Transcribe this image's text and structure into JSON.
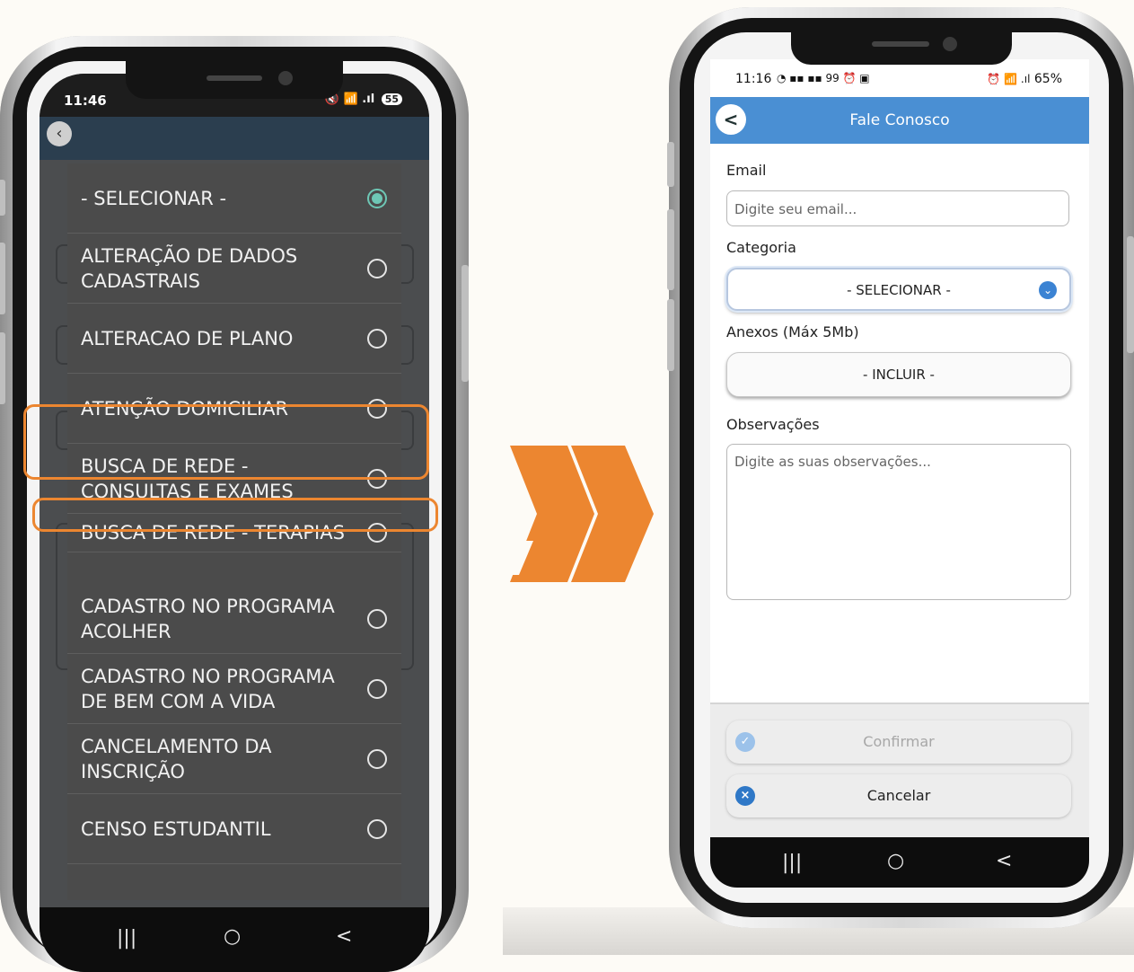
{
  "left_phone": {
    "status_bar": {
      "time": "11:46",
      "icons": "🔇 📶 .ıl",
      "battery": "55"
    },
    "dropdown": {
      "items": [
        {
          "label": "- SELECIONAR -",
          "selected": true
        },
        {
          "label": "ALTERAÇÃO DE DADOS\nCADASTRAIS",
          "selected": false
        },
        {
          "label": "ALTERACAO DE PLANO",
          "selected": false
        },
        {
          "label": "ATENÇÃO DOMICILIAR",
          "selected": false
        },
        {
          "label": "BUSCA DE REDE -\nCONSULTAS E EXAMES",
          "selected": false
        },
        {
          "label": "BUSCA DE REDE - TERAPIAS",
          "selected": false
        },
        {
          "label": "CADASTRO NO PROGRAMA\nACOLHER",
          "selected": false
        },
        {
          "label": "CADASTRO NO PROGRAMA\nDE BEM COM A VIDA",
          "selected": false
        },
        {
          "label": "CANCELAMENTO DA\nINSCRIÇÃO",
          "selected": false
        },
        {
          "label": "CENSO ESTUDANTIL",
          "selected": false
        }
      ]
    },
    "nav": {
      "recents": "|||",
      "home": "○",
      "back": "<"
    }
  },
  "right_phone": {
    "status_bar": {
      "time": "11:16",
      "icons_left": "◔ ▪▪ ▪▪ 99 ⏰ ▣",
      "icons_right": "⏰ 📶 .ıl",
      "battery": "65%"
    },
    "header": {
      "back": "<",
      "title": "Fale Conosco"
    },
    "form": {
      "email_label": "Email",
      "email_placeholder": "Digite seu email...",
      "category_label": "Categoria",
      "category_value": "- SELECIONAR -",
      "attachments_label": "Anexos (Máx 5Mb)",
      "attachments_button": "- INCLUIR -",
      "notes_label": "Observações",
      "notes_placeholder": "Digite as suas observações..."
    },
    "footer": {
      "confirm": "Confirmar",
      "cancel": "Cancelar"
    },
    "nav": {
      "recents": "|||",
      "home": "○",
      "back": "<"
    }
  },
  "colors": {
    "accent_orange": "#EC8630",
    "header_blue": "#4A8FD3",
    "radio_selected": "#6EC7B5"
  }
}
